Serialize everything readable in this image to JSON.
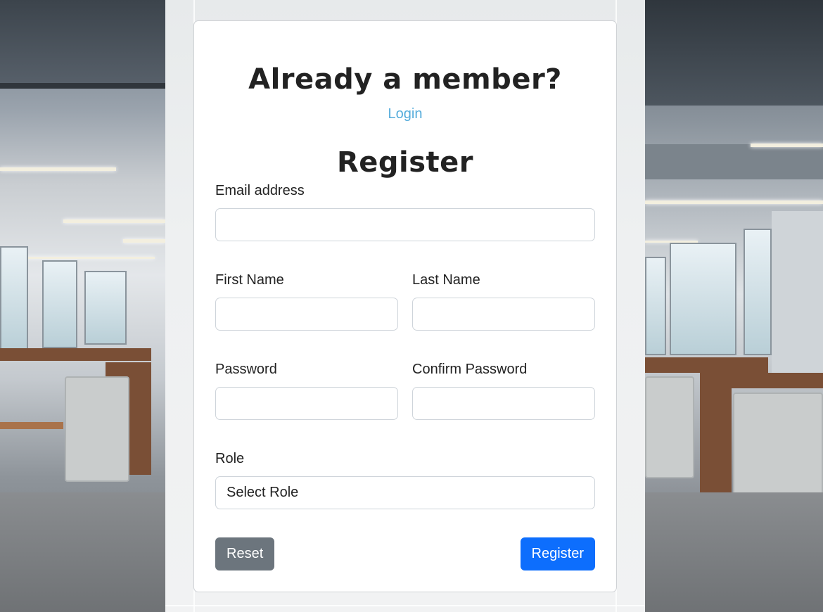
{
  "login_prompt": {
    "title": "Already a member?",
    "login_link": "Login"
  },
  "register_form": {
    "title": "Register",
    "email": {
      "label": "Email address",
      "value": "",
      "placeholder": ""
    },
    "first_name": {
      "label": "First Name",
      "value": "",
      "placeholder": ""
    },
    "last_name": {
      "label": "Last Name",
      "value": "",
      "placeholder": ""
    },
    "password": {
      "label": "Password",
      "value": "",
      "placeholder": ""
    },
    "confirm_password": {
      "label": "Confirm Password",
      "value": "",
      "placeholder": ""
    },
    "role": {
      "label": "Role",
      "selected": "Select Role"
    },
    "reset_label": "Reset",
    "register_label": "Register"
  },
  "colors": {
    "link": "#55acdb",
    "primary_button": "#0d6efd",
    "secondary_button": "#6c757d"
  }
}
